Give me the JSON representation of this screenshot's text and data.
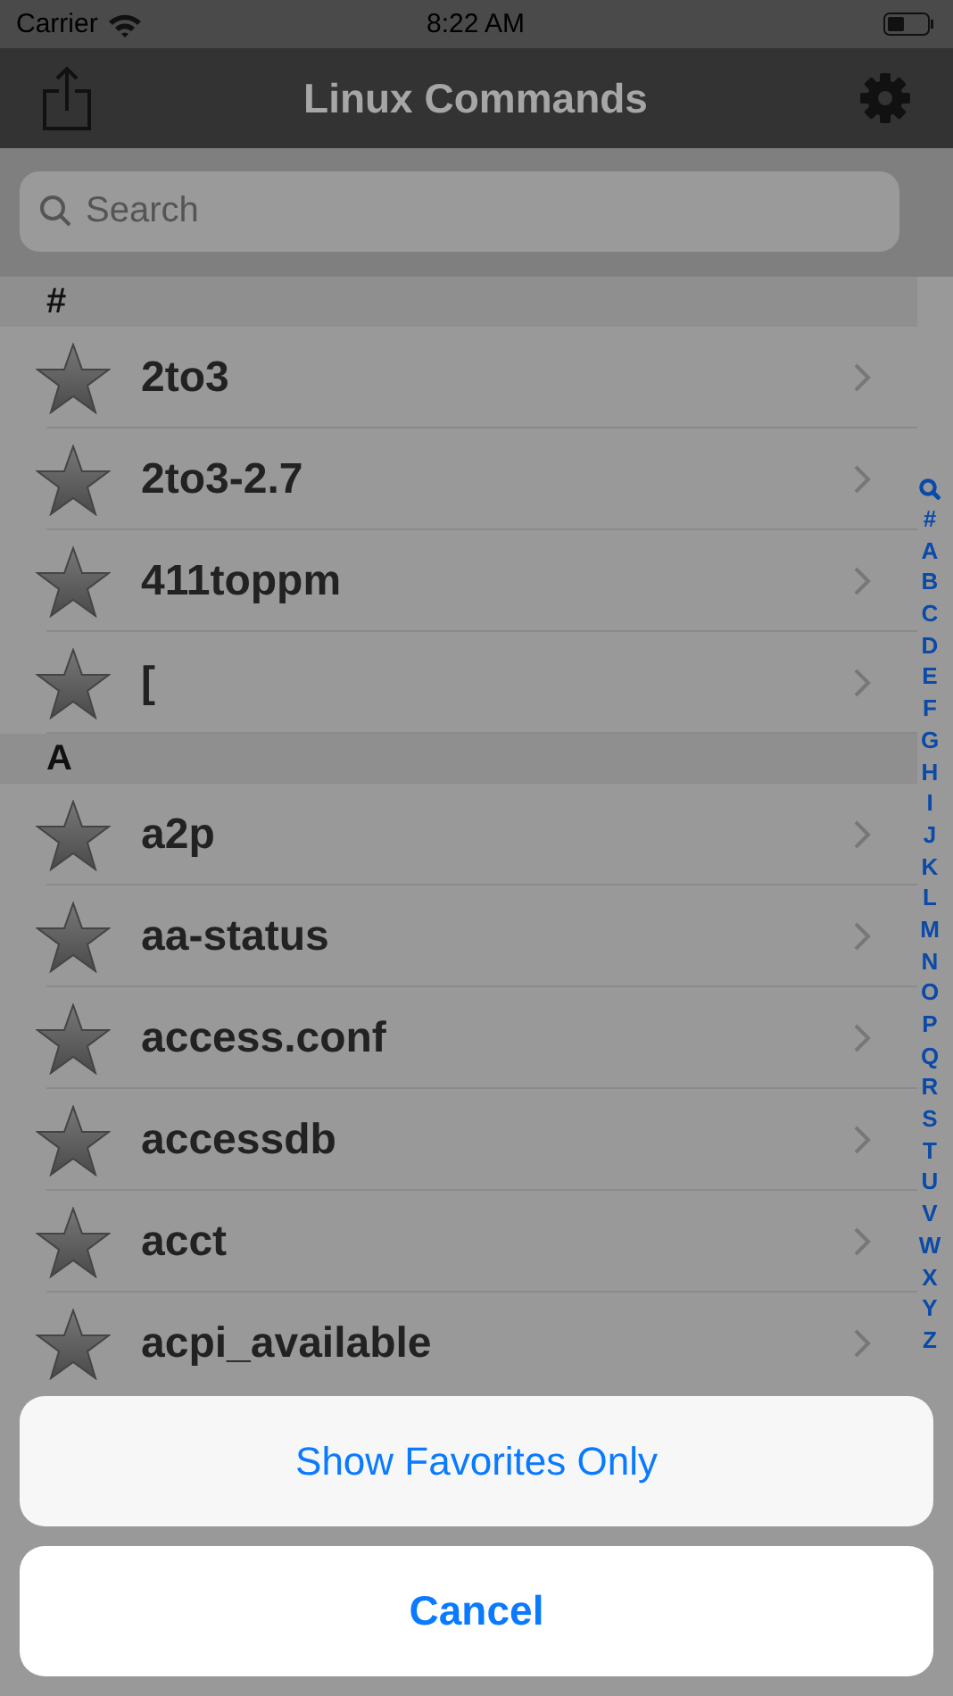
{
  "status_bar": {
    "carrier": "Carrier",
    "time": "8:22 AM"
  },
  "nav": {
    "title": "Linux Commands"
  },
  "search": {
    "placeholder": "Search"
  },
  "sections": [
    {
      "title": "#",
      "rows": [
        "2to3",
        "2to3-2.7",
        "411toppm",
        "["
      ]
    },
    {
      "title": "A",
      "rows": [
        "a2p",
        "aa-status",
        "access.conf",
        "accessdb",
        "acct",
        "acpi_available"
      ]
    }
  ],
  "index": [
    "#",
    "A",
    "B",
    "C",
    "D",
    "E",
    "F",
    "G",
    "H",
    "I",
    "J",
    "K",
    "L",
    "M",
    "N",
    "O",
    "P",
    "Q",
    "R",
    "S",
    "T",
    "U",
    "V",
    "W",
    "X",
    "Y",
    "Z"
  ],
  "action_sheet": {
    "actions": [
      "Show Favorites Only"
    ],
    "cancel": "Cancel"
  }
}
